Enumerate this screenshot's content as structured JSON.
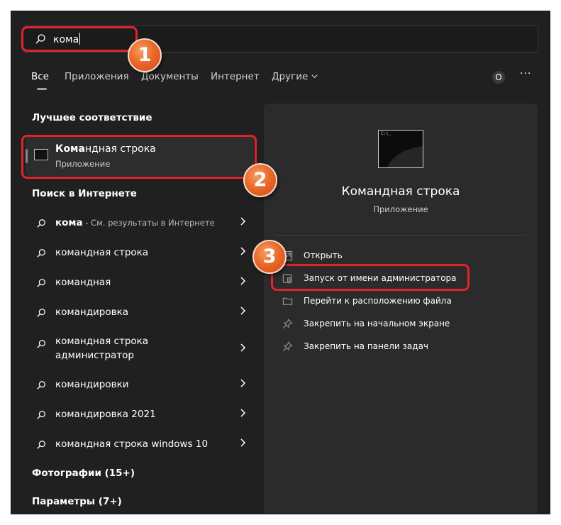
{
  "search": {
    "query": "кома"
  },
  "tabs": [
    {
      "label": "Все"
    },
    {
      "label": "Приложения"
    },
    {
      "label": "Документы"
    },
    {
      "label": "Интернет"
    },
    {
      "label": "Другие"
    }
  ],
  "header": {
    "avatar_letter": "O",
    "more": "···"
  },
  "best_match": {
    "section": "Лучшее соответствие",
    "title_bold": "Кома",
    "title_rest": "ндная строка",
    "subtitle": "Приложение"
  },
  "web": {
    "section": "Поиск в Интернете",
    "first": {
      "bold": "кома",
      "rest": " - См. результаты в Интернете"
    },
    "items": [
      "командная строка",
      "командная",
      "командировка",
      "командная строка администратор",
      "командировки",
      "командировка 2021",
      "командная строка windows 10"
    ]
  },
  "sections": {
    "photos": "Фотографии (15+)",
    "settings": "Параметры (7+)"
  },
  "preview": {
    "title": "Командная строка",
    "subtitle": "Приложение",
    "icon_text": "C:\\_",
    "actions": [
      {
        "label": "Открыть",
        "icon": "open-icon"
      },
      {
        "label": "Запуск от имени администратора",
        "icon": "shield-icon"
      },
      {
        "label": "Перейти к расположению файла",
        "icon": "folder-icon"
      },
      {
        "label": "Закрепить на начальном экране",
        "icon": "pin-icon"
      },
      {
        "label": "Закрепить на панели задач",
        "icon": "pin-icon"
      }
    ]
  },
  "badges": [
    "1",
    "2",
    "3"
  ],
  "colors": {
    "highlight": "#e0242c",
    "badge": "#ea6a2a",
    "background": "#202020",
    "panel": "#2b2b2b"
  }
}
